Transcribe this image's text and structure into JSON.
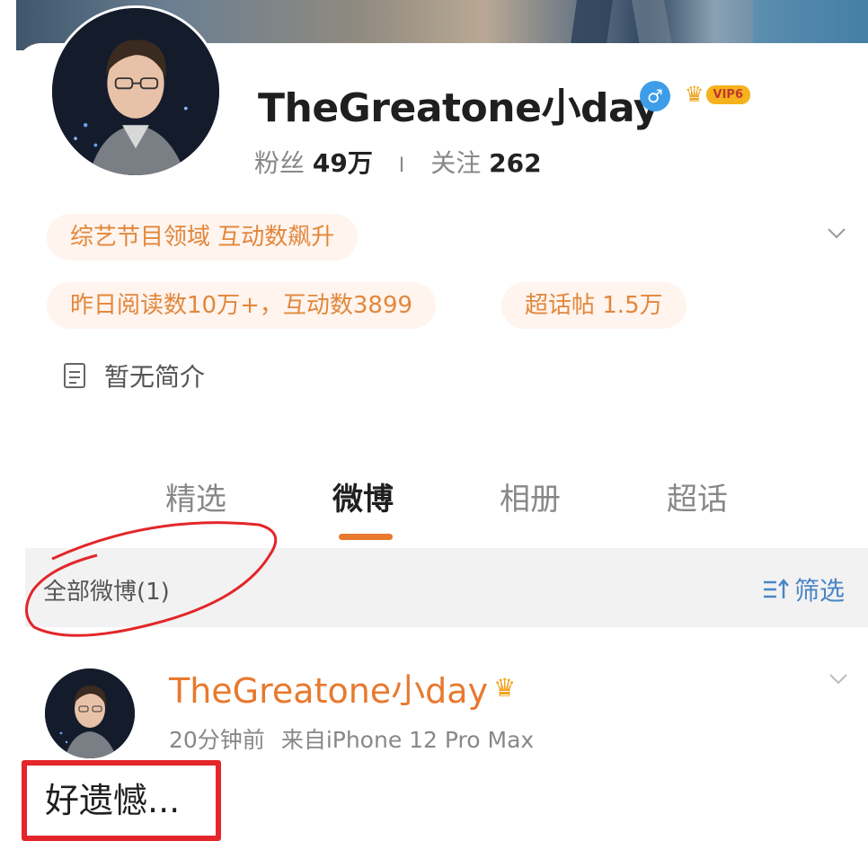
{
  "profile": {
    "username": "TheGreatone小day",
    "gender_icon": "male-icon",
    "vip_label": "VIP6",
    "followers_label": "粉丝",
    "followers_value": "49万",
    "separator": "I",
    "following_label": "关注",
    "following_value": "262"
  },
  "tags": {
    "domain_tag": "综艺节目领域 互动数飙升",
    "reads_tag": "昨日阅读数10万+，互动数3899",
    "topic_tag": "超话帖 1.5万"
  },
  "intro": {
    "text": "暂无简介"
  },
  "tabs": [
    {
      "label": "精选",
      "active": false
    },
    {
      "label": "微博",
      "active": true
    },
    {
      "label": "相册",
      "active": false
    },
    {
      "label": "超话",
      "active": false
    }
  ],
  "filter": {
    "count_label": "全部微博(1)",
    "filter_label": "筛选"
  },
  "post": {
    "author": "TheGreatone小day",
    "time": "20分钟前",
    "source": "来自iPhone 12 Pro Max",
    "text": "好遗憾..."
  },
  "colors": {
    "accent": "#e8792e",
    "pill_bg": "#fff4ee",
    "annotation_red": "#e3262a",
    "link_blue": "#4a86c7"
  }
}
